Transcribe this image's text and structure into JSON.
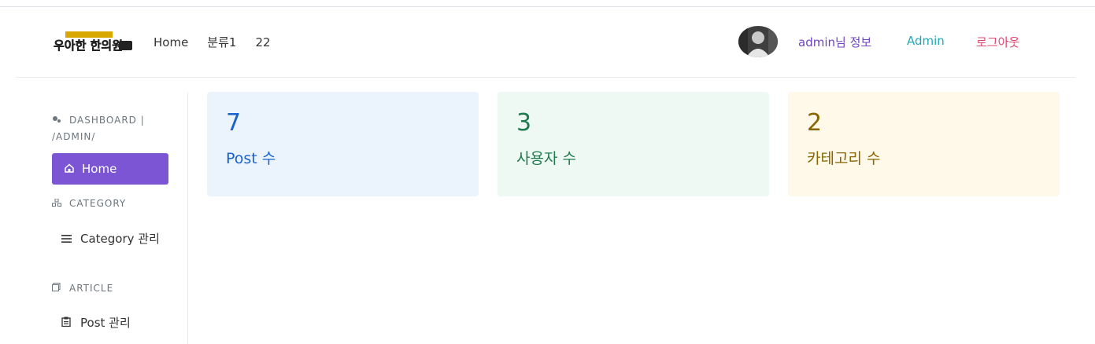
{
  "navbar": {
    "logo_text": "우아한 한의원",
    "links": [
      "Home",
      "분류1",
      "22"
    ],
    "user_info": "admin님 정보",
    "admin": "Admin",
    "logout": "로그아웃"
  },
  "sidebar": {
    "dashboard_heading": "DASHBOARD | /ADMIN/",
    "home": "Home",
    "category_heading": "CATEGORY",
    "category_item": "Category 관리",
    "article_heading": "ARTICLE",
    "post_item": "Post 관리"
  },
  "cards": [
    {
      "value": "7",
      "label": "Post 수",
      "color": "#1a62c9"
    },
    {
      "value": "3",
      "label": "사용자 수",
      "color": "#1f7a4f"
    },
    {
      "value": "2",
      "label": "카테고리 수",
      "color": "#8a6400"
    }
  ]
}
